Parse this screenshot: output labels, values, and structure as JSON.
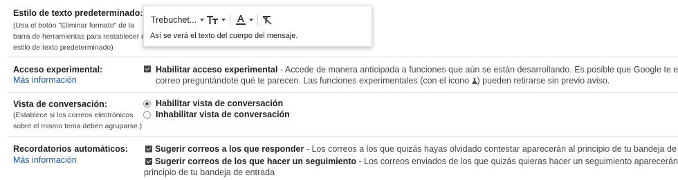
{
  "text_style": {
    "title": "Estilo de texto predeterminado:",
    "desc_lines": [
      "(Usa el botón \"Eliminar formato\" de la",
      "barra de herramientas para restablecer el",
      "estilo de texto predeterminado)"
    ],
    "font_value": "Trebuchet...",
    "preview": "Así se verá el texto del cuerpo del mensaje."
  },
  "experimental": {
    "title": "Acceso experimental:",
    "link": "Más información",
    "option_label": "Habilitar acceso experimental",
    "option_desc": " - Accede de manera anticipada a funciones que aún se están desarrollando. Es posible que Google te envíe un",
    "line2_a": "correo preguntándote qué te parecen. Las funciones experimentales (con el icono ",
    "line2_b": ") pueden retirarse sin previo aviso."
  },
  "conversation": {
    "title": "Vista de conversación:",
    "desc_lines": [
      "(Establece si los correos electrónicos",
      "sobre el mismo tema deben agruparse.)"
    ],
    "options": [
      "Habilitar vista de conversación",
      "Inhabilitar vista de conversación"
    ]
  },
  "nudges": {
    "title": "Recordatorios automáticos:",
    "link": "Más información",
    "opt1_label": "Sugerir correos a los que responder",
    "opt1_desc": " - Los correos a los que quizás hayas olvidado contestar aparecerán al principio de tu bandeja de entrada",
    "opt2_label": "Sugerir correos de los que hacer un seguimiento",
    "opt2_desc": " - Los correos enviados de los que quizás quieras hacer un seguimiento aparecerán al",
    "opt2_line2": "principio de tu bandeja de entrada"
  }
}
